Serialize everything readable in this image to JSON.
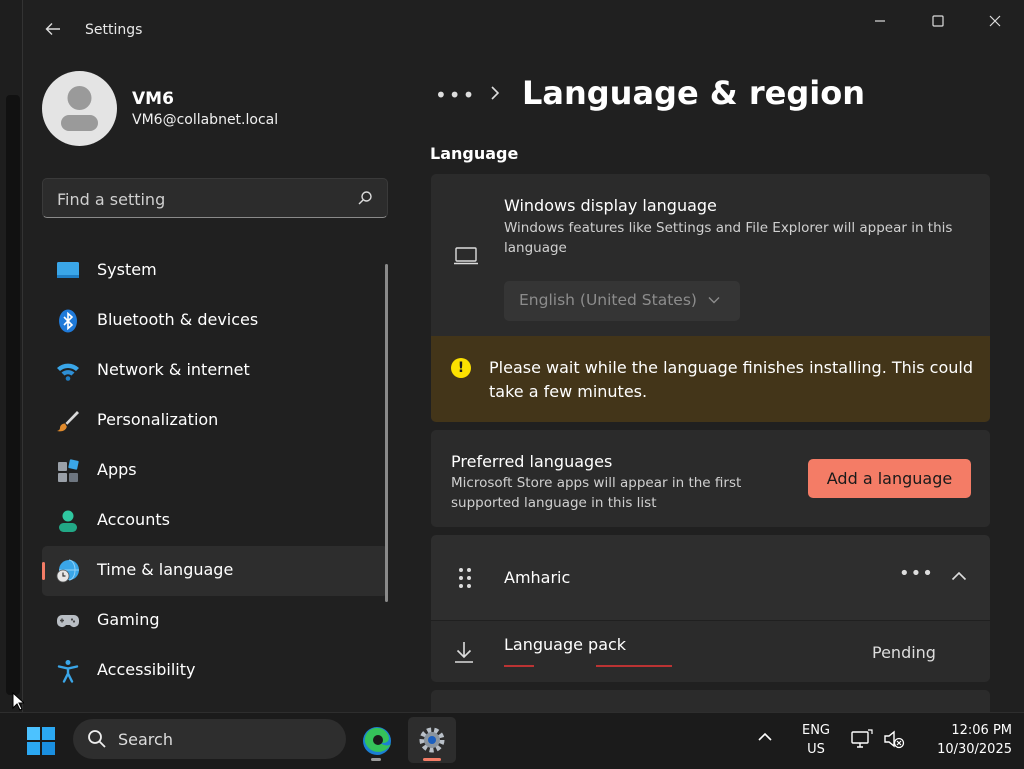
{
  "window": {
    "title": "Settings",
    "controls": [
      "minimize",
      "maximize",
      "close"
    ]
  },
  "user": {
    "name": "VM6",
    "email": "VM6@collabnet.local"
  },
  "search": {
    "placeholder": "Find a setting"
  },
  "nav": {
    "items": [
      {
        "label": "System",
        "icon": "system-icon",
        "selected": false
      },
      {
        "label": "Bluetooth & devices",
        "icon": "bluetooth-icon",
        "selected": false
      },
      {
        "label": "Network & internet",
        "icon": "wifi-icon",
        "selected": false
      },
      {
        "label": "Personalization",
        "icon": "brush-icon",
        "selected": false
      },
      {
        "label": "Apps",
        "icon": "apps-icon",
        "selected": false
      },
      {
        "label": "Accounts",
        "icon": "accounts-icon",
        "selected": false
      },
      {
        "label": "Time & language",
        "icon": "globe-clock-icon",
        "selected": true
      },
      {
        "label": "Gaming",
        "icon": "gamepad-icon",
        "selected": false
      },
      {
        "label": "Accessibility",
        "icon": "accessibility-icon",
        "selected": false
      }
    ]
  },
  "page": {
    "breadcrumb_more": "•••",
    "title": "Language & region",
    "section": "Language"
  },
  "display_language": {
    "title": "Windows display language",
    "description": "Windows features like Settings and File Explorer will appear in this language",
    "selected": "English (United States)"
  },
  "warning": {
    "text": "Please wait while the language finishes installing. This could take a few minutes."
  },
  "preferred": {
    "title": "Preferred languages",
    "description": "Microsoft Store apps will appear in the first supported language in this list",
    "button": "Add a language"
  },
  "languages": [
    {
      "name": "Amharic",
      "more": "•••"
    }
  ],
  "language_pack": {
    "label": "Language pack",
    "status": "Pending"
  },
  "taskbar": {
    "search_label": "Search",
    "lang_line1": "ENG",
    "lang_line2": "US",
    "time": "12:06 PM",
    "date": "10/30/2025"
  },
  "colors": {
    "accent": "#f47c66",
    "warning_bg": "#433519",
    "warning_icon": "#fce100"
  }
}
